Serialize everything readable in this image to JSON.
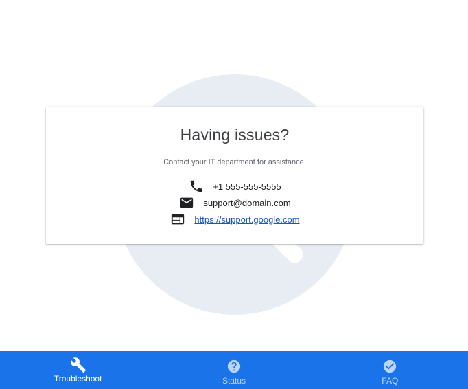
{
  "card": {
    "title": "Having issues?",
    "subtitle": "Contact your IT department for assistance.",
    "contacts": [
      {
        "icon": "phone-icon",
        "text": "+1 555-555-5555"
      },
      {
        "icon": "email-icon",
        "text": "support@domain.com"
      },
      {
        "icon": "web-icon",
        "text": "https://support.google.com"
      }
    ]
  },
  "bottom_nav": {
    "items": [
      {
        "label": "Troubleshoot",
        "icon": "wrench-icon",
        "active": true
      },
      {
        "label": "Status",
        "icon": "help-circle-icon",
        "active": false
      },
      {
        "label": "FAQ",
        "icon": "check-circle-icon",
        "active": false
      }
    ]
  },
  "colors": {
    "nav_background": "#1a73e8",
    "illustration": "#e8edf4",
    "link": "#1a56c4"
  }
}
